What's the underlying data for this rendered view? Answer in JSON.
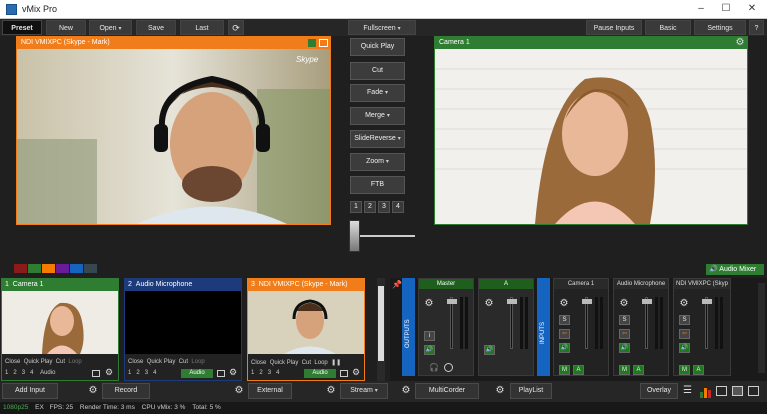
{
  "window": {
    "title": "vMix Pro",
    "min": "–",
    "max": "☐",
    "close": "✕"
  },
  "toolbar": {
    "preset": "Preset",
    "new": "New",
    "open": "Open",
    "save": "Save",
    "last": "Last",
    "fullscreen": "Fullscreen",
    "pause_inputs": "Pause Inputs",
    "basic": "Basic",
    "settings": "Settings",
    "help": "?"
  },
  "preview": {
    "title": "NDI VMIXPC (Skype - Mark)",
    "watermark": "Skype"
  },
  "output": {
    "title": "Camera 1"
  },
  "transitions": {
    "quick_play": "Quick Play",
    "cut": "Cut",
    "fade": "Fade",
    "merge": "Merge",
    "slide_reverse": "SlideReverse",
    "zoom": "Zoom",
    "ftb": "FTB",
    "numbers": [
      "1",
      "2",
      "3",
      "4"
    ]
  },
  "colors": {
    "swatches": [
      "#8b1a1a",
      "#2e7d32",
      "#f57c00",
      "#6a1b9a",
      "#1565c0",
      "#37474f"
    ],
    "green": "#2e7d32",
    "orange": "#f07d1a",
    "blue": "#1d3a7a"
  },
  "audio_mixer_label": "Audio Mixer",
  "inputs": [
    {
      "num": "1",
      "name": "Camera 1",
      "row1": [
        "Close",
        "Quick Play",
        "Cut",
        "Loop"
      ],
      "row2": [
        "1",
        "2",
        "3",
        "4"
      ],
      "audio": "Audio"
    },
    {
      "num": "2",
      "name": "Audio Microphone",
      "row1": [
        "Close",
        "Quick Play",
        "Cut",
        "Loop"
      ],
      "row2": [
        "1",
        "2",
        "3",
        "4"
      ],
      "audio": "Audio"
    },
    {
      "num": "3",
      "name": "NDI VMIXPC (Skype - Mark)",
      "row1": [
        "Close",
        "Quick Play",
        "Cut",
        "Loop"
      ],
      "row2": [
        "1",
        "2",
        "3",
        "4"
      ],
      "audio": "Audio"
    }
  ],
  "mixer": {
    "outputs_label": "OUTPUTS",
    "inputs_label": "INPUTS",
    "strips": [
      {
        "name": "Master"
      },
      {
        "name": "A"
      },
      {
        "name": "Camera 1"
      },
      {
        "name": "Audio Microphone"
      },
      {
        "name": "NDI VMIXPC (Skyp"
      }
    ],
    "s": "S",
    "m": "M",
    "a": "A"
  },
  "bottom": {
    "add_input": "Add Input",
    "record": "Record",
    "external": "External",
    "stream": "Stream",
    "multicorder": "MultiCorder",
    "playlist": "PlayList",
    "overlay": "Overlay"
  },
  "status": {
    "format": "1080p25",
    "ex": "EX",
    "fps_label": "FPS:",
    "fps": "25",
    "render_label": "Render Time:",
    "render": "3 ms",
    "cpu_label": "CPU vMix:",
    "cpu": "3 %",
    "total_label": "Total:",
    "total": "5 %"
  }
}
